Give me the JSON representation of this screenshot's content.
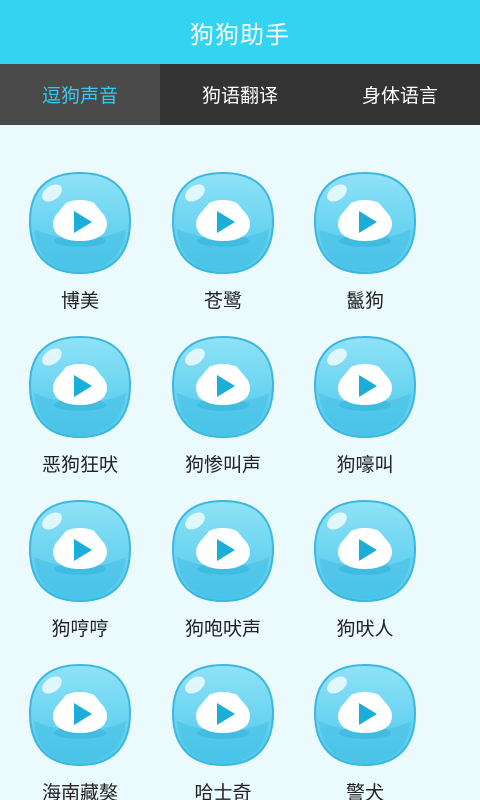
{
  "app": {
    "title": "狗狗助手"
  },
  "tabs": [
    {
      "label": "逗狗声音",
      "active": true
    },
    {
      "label": "狗语翻译",
      "active": false
    },
    {
      "label": "身体语言",
      "active": false
    }
  ],
  "sounds": [
    {
      "label": "博美"
    },
    {
      "label": "苍鹭"
    },
    {
      "label": "鬣狗"
    },
    {
      "label": "恶狗狂吠"
    },
    {
      "label": "狗惨叫声"
    },
    {
      "label": "狗嚎叫"
    },
    {
      "label": "狗哼哼"
    },
    {
      "label": "狗咆吠声"
    },
    {
      "label": "狗吠人"
    },
    {
      "label": "海南藏獒"
    },
    {
      "label": "哈士奇"
    },
    {
      "label": "警犬"
    }
  ],
  "icons": {
    "sound_button": "play-icon"
  },
  "colors": {
    "header": "#33d4f2",
    "tab_bar": "#333333",
    "tab_active_bg": "#4a4a4a",
    "tab_active_text": "#33ccf0",
    "background": "#ebfafd",
    "bubble": "#60d2ef",
    "play": "#1aaed8"
  }
}
